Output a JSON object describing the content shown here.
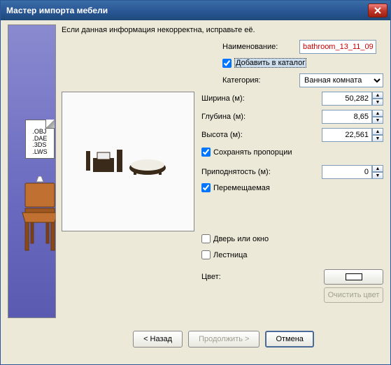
{
  "window": {
    "title": "Мастер импорта мебели"
  },
  "sidebar": {
    "formats": ".OBJ\n.DAE\n.3DS\n.LWS"
  },
  "intro": "Если данная информация некорректна, исправьте её.",
  "labels": {
    "name": "Наименование:",
    "add_catalog": "Добавить в каталог",
    "category": "Категория:",
    "width": "Ширина (м):",
    "depth": "Глубина (м):",
    "height": "Высота (м):",
    "keep_prop": "Сохранять пропорции",
    "elevation": "Приподнятость (м):",
    "movable": "Перемещаемая",
    "door": "Дверь или окно",
    "stair": "Лестница",
    "color": "Цвет:",
    "clear_color": "Очистить цвет"
  },
  "values": {
    "name": "bathroom_13_11_09",
    "add_catalog": true,
    "category": "Ванная комната",
    "width": "50,282",
    "depth": "8,65",
    "height": "22,561",
    "keep_prop": true,
    "elevation": "0",
    "movable": true,
    "door": false,
    "stair": false
  },
  "buttons": {
    "back": "< Назад",
    "next": "Продолжить >",
    "cancel": "Отмена"
  }
}
